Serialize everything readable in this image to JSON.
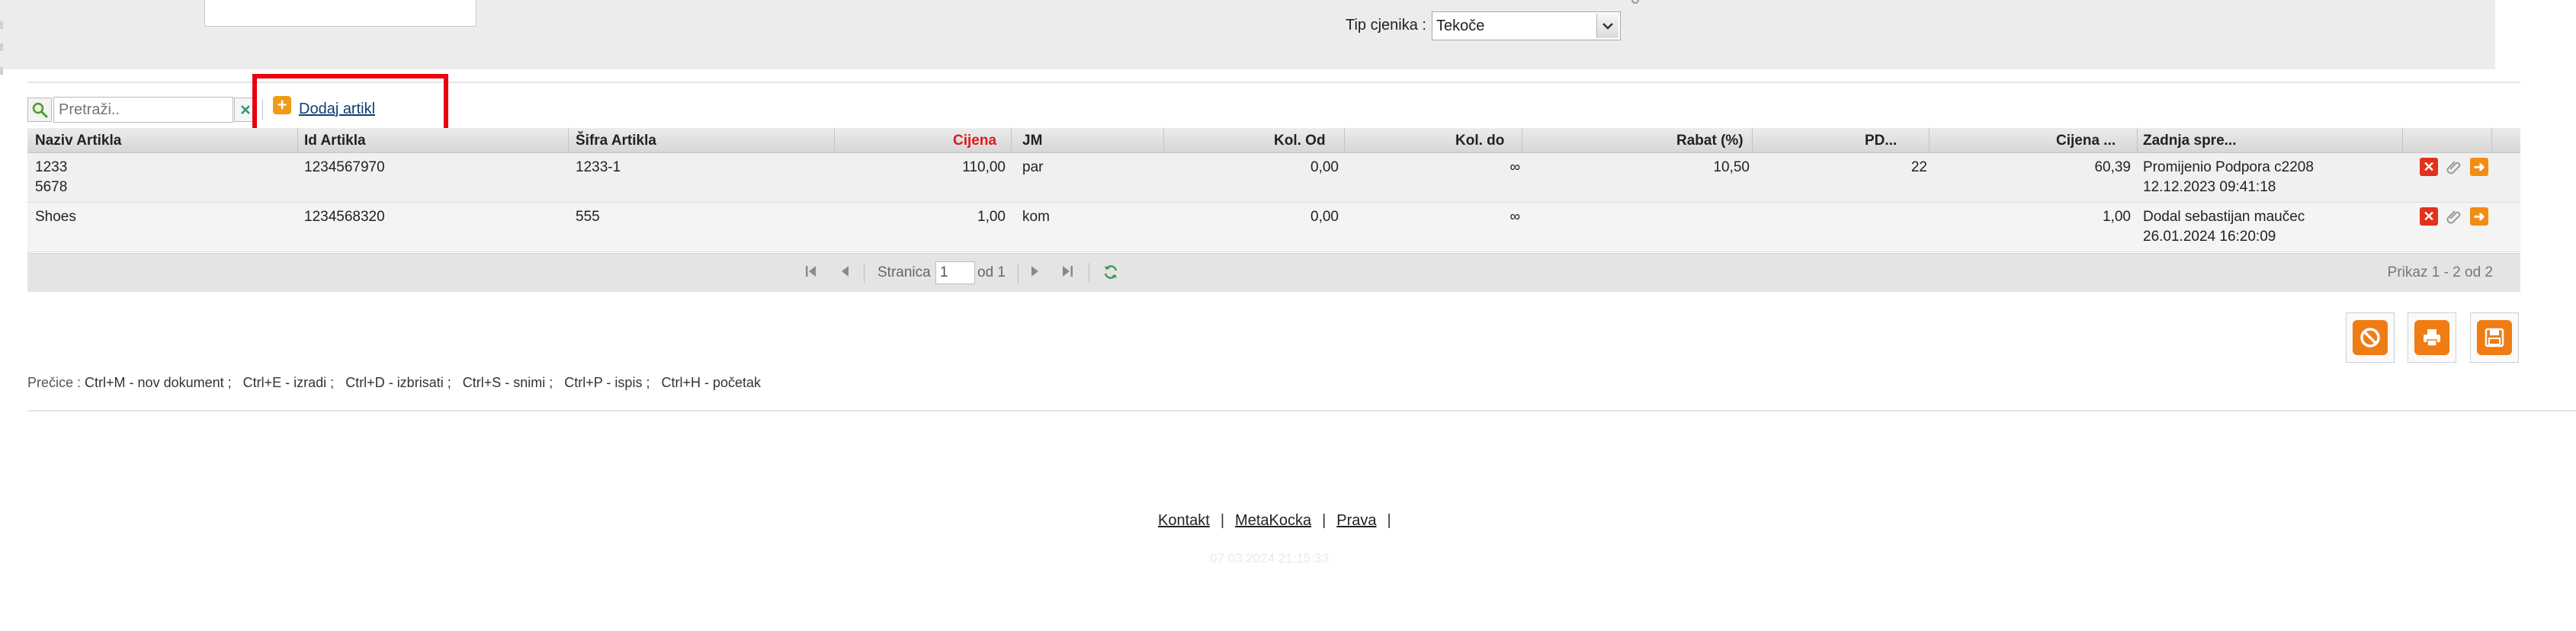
{
  "form": {
    "tip_cjenika_label": "Tip cjenika :",
    "tip_cjenika_value": "Tekoče"
  },
  "toolbar": {
    "search_placeholder": "Pretraži..",
    "add_label": "Dodaj artikl"
  },
  "grid": {
    "headers": {
      "naziv": "Naziv Artikla",
      "id": "Id Artikla",
      "sifra": "Šifra Artikla",
      "cijena": "Cijena",
      "jm": "JM",
      "kol_od": "Kol. Od",
      "kol_do": "Kol. do",
      "rabat": "Rabat (%)",
      "pdv": "PD...",
      "cijena2": "Cijena ...",
      "zadnja": "Zadnja spre..."
    },
    "rows": [
      {
        "naziv_line1": "1233",
        "naziv_line2": "5678",
        "id": "1234567970",
        "sifra": "1233-1",
        "cijena": "110,00",
        "jm": "par",
        "kol_od": "0,00",
        "kol_do": "∞",
        "rabat": "10,50",
        "pdv": "22",
        "cijena2": "60,39",
        "zadnja_line1": "Promijenio Podpora c2208",
        "zadnja_line2": "12.12.2023 09:41:18"
      },
      {
        "naziv_line1": "Shoes",
        "naziv_line2": "",
        "id": "1234568320",
        "sifra": "555",
        "cijena": "1,00",
        "jm": "kom",
        "kol_od": "0,00",
        "kol_do": "∞",
        "rabat": "",
        "pdv": "",
        "cijena2": "1,00",
        "zadnja_line1": "Dodal sebastijan maučec",
        "zadnja_line2": "26.01.2024 16:20:09"
      }
    ]
  },
  "pager": {
    "page_label": "Stranica",
    "page_value": "1",
    "of_label": "od 1",
    "summary": "Prikaz 1 - 2 od 2"
  },
  "shortcuts": {
    "label": "Prečice :",
    "items": [
      "Ctrl+M - nov dokument ;",
      "Ctrl+E - izradi ;",
      "Ctrl+D - izbrisati ;",
      "Ctrl+S - snimi ;",
      "Ctrl+P - ispis ;",
      "Ctrl+H - početak"
    ]
  },
  "footer": {
    "links": [
      "Kontakt",
      "MetaKocka",
      "Prava"
    ],
    "timestamp": "07.03.2024 21:15:33"
  },
  "colors": {
    "highlight": "#e8020b",
    "accent_orange": "#f07c14",
    "price_header": "#d81c1c",
    "link": "#0c3f72"
  },
  "icons": {
    "search": "search-icon",
    "clear": "clear-icon",
    "add": "add-icon",
    "delete": "delete-icon",
    "attach": "paperclip-icon",
    "open": "arrow-right-icon",
    "cancel": "cancel-icon",
    "print": "print-icon",
    "save": "save-icon",
    "refresh": "refresh-icon"
  }
}
